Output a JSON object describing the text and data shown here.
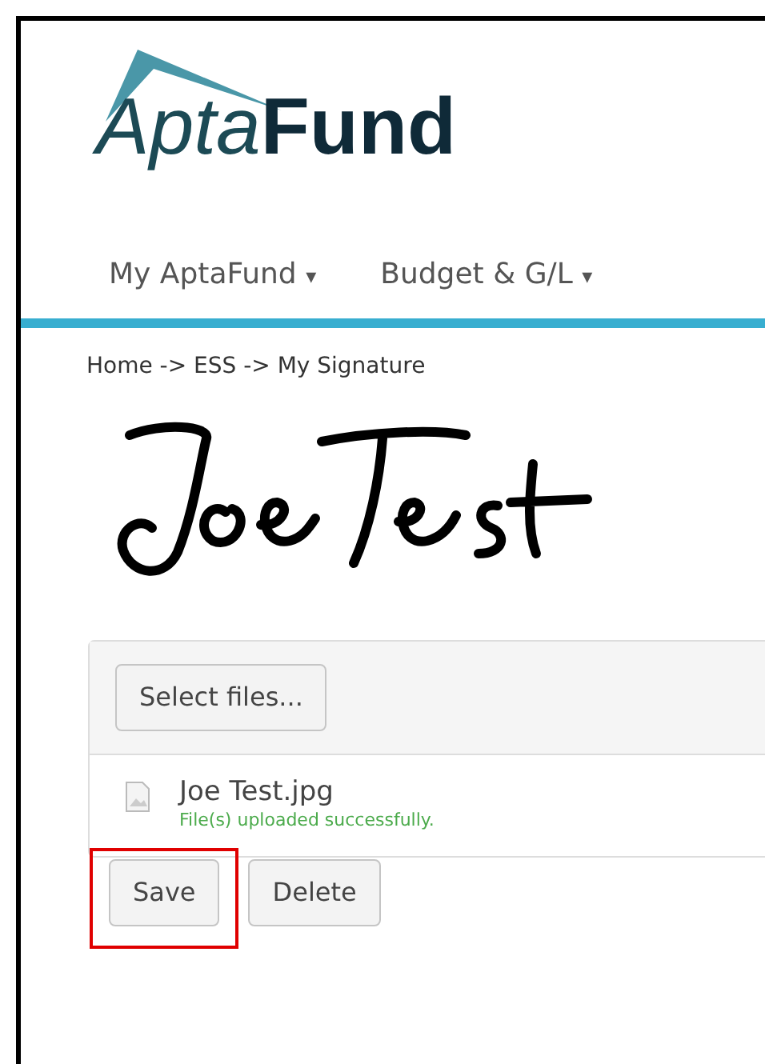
{
  "logo": {
    "part_1": "Apta",
    "part_2": "Fund"
  },
  "nav": [
    {
      "label": "My AptaFund",
      "caret": "▾"
    },
    {
      "label": "Budget & G/L",
      "caret": "▾"
    }
  ],
  "breadcrumb": "Home -> ESS -> My Signature",
  "upload": {
    "button": "Select files...",
    "files": [
      {
        "name": "Joe Test.jpg",
        "status": "File(s) uploaded successfully."
      }
    ]
  },
  "actions": [
    {
      "label": "Save",
      "highlighted": true
    },
    {
      "label": "Delete",
      "highlighted": false
    }
  ]
}
